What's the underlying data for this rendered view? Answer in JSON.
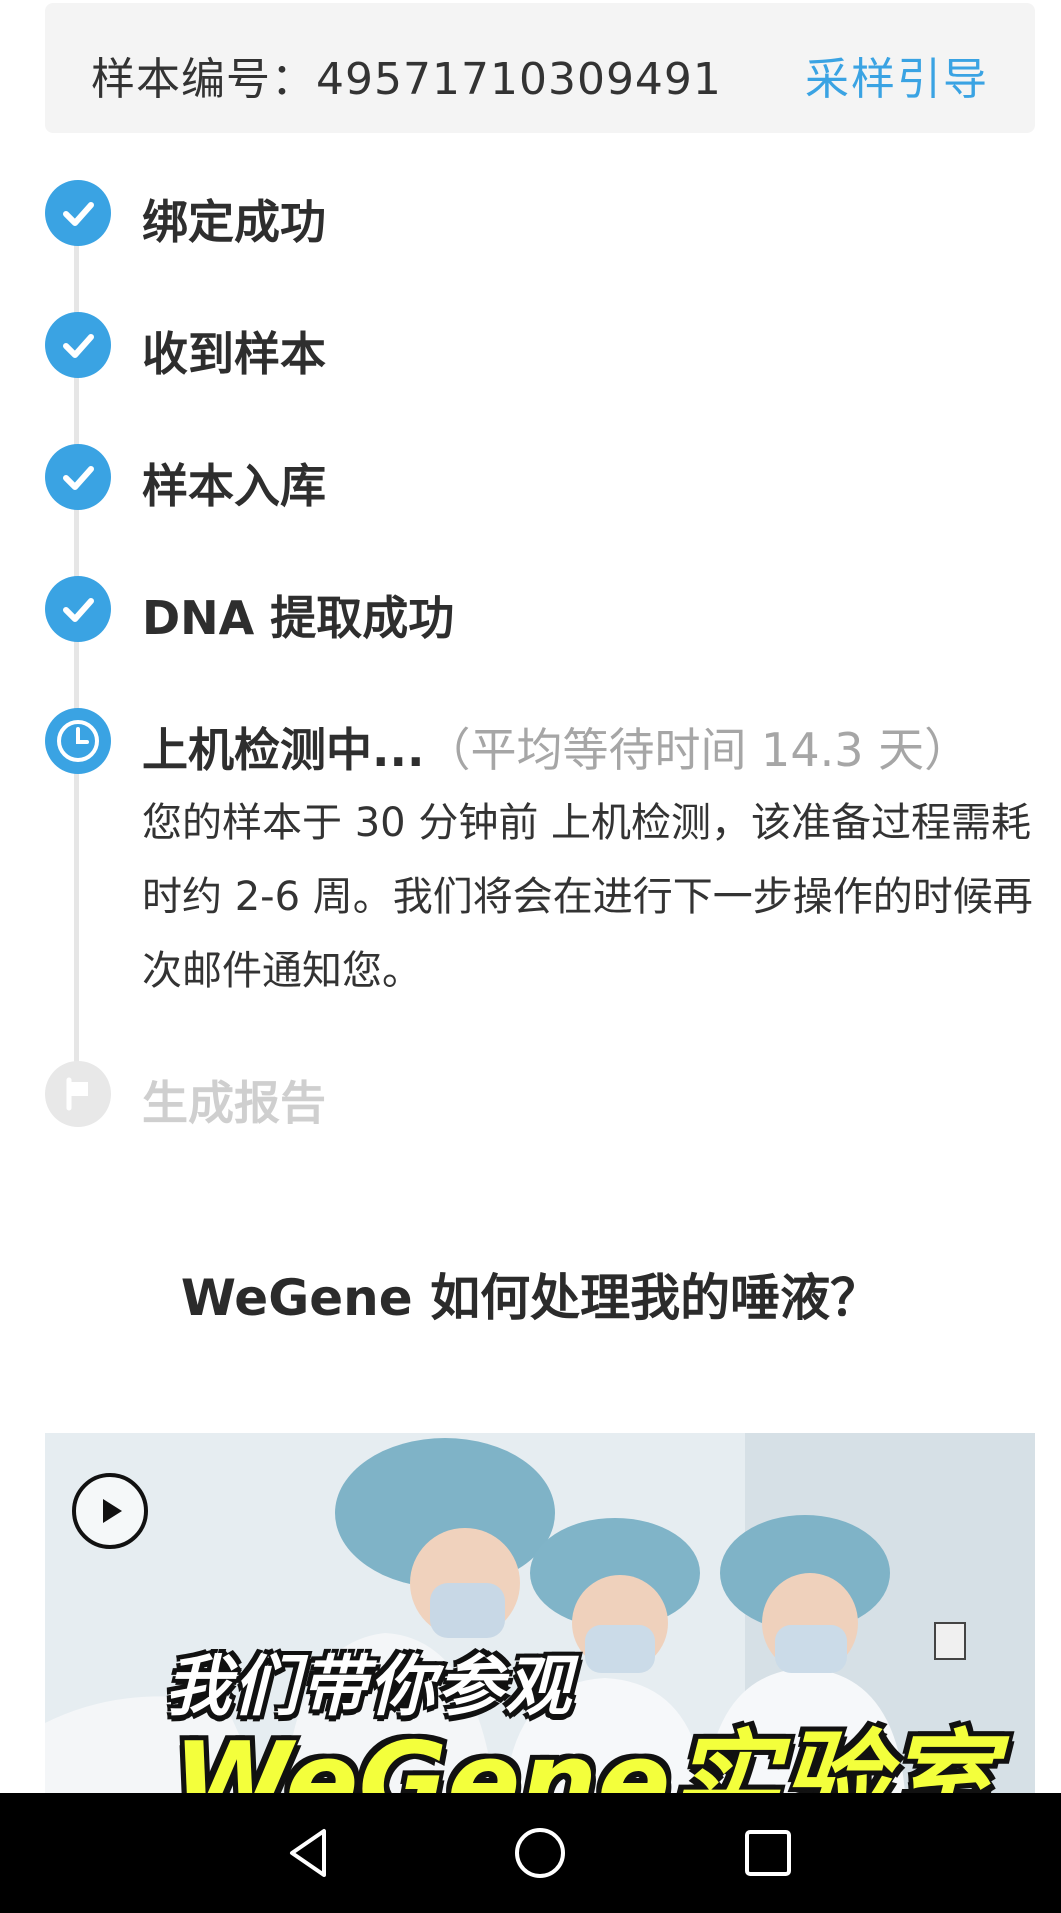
{
  "sample": {
    "label": "样本编号：49571710309491",
    "guide_link": "采样引导"
  },
  "steps": [
    {
      "title": "绑定成功",
      "status": "done",
      "icon": "check-icon"
    },
    {
      "title": "收到样本",
      "status": "done",
      "icon": "check-icon"
    },
    {
      "title": "样本入库",
      "status": "done",
      "icon": "check-icon"
    },
    {
      "title": "DNA 提取成功",
      "status": "done",
      "icon": "check-icon"
    },
    {
      "title": "上机检测中...",
      "status": "current",
      "icon": "clock-icon",
      "wait_hint": "（平均等待时间 14.3 天）",
      "description": "您的样本于 30 分钟前 上机检测，该准备过程需耗时约 2-6 周。我们将会在进行下一步操作的时候再次邮件通知您。"
    },
    {
      "title": "生成报告",
      "status": "pending",
      "icon": "flag-icon"
    }
  ],
  "section": {
    "heading": "WeGene 如何处理我的唾液？"
  },
  "video": {
    "overlay_line1": "我们带你参观",
    "overlay_line2": "WeGene实验室",
    "play_icon": "play-icon"
  },
  "nav": {
    "back_icon": "back-triangle-icon",
    "home_icon": "home-circle-icon",
    "recents_icon": "recents-square-icon"
  },
  "colors": {
    "accent": "#3aa3e3",
    "pending": "#e8e8e8",
    "overlay_yellow": "#f3ff3c"
  }
}
